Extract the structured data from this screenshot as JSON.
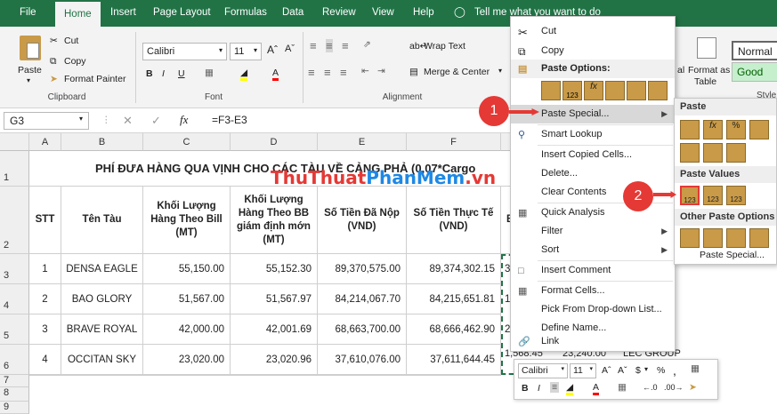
{
  "ribbon_tabs": [
    "File",
    "Home",
    "Insert",
    "Page Layout",
    "Formulas",
    "Data",
    "Review",
    "View",
    "Help"
  ],
  "tell_me": "Tell me what you want to do",
  "clipboard": {
    "paste": "Paste",
    "cut": "Cut",
    "copy": "Copy",
    "format_painter": "Format Painter",
    "label": "Clipboard"
  },
  "font": {
    "name": "Calibri",
    "size": "11",
    "label": "Font",
    "bold": "B",
    "italic": "I",
    "underline": "U"
  },
  "alignment": {
    "wrap": "Wrap Text",
    "merge": "Merge & Center",
    "label": "Alignment"
  },
  "styles": {
    "format_as": "Format as",
    "table": "Table",
    "normal": "Normal",
    "good": "Good",
    "style_partial": "Style",
    "al_partial": "al"
  },
  "formula_bar": {
    "name_box": "G3",
    "fx": "fx",
    "formula": "=F3-E3"
  },
  "columns": [
    "A",
    "B",
    "C",
    "D",
    "E",
    "F"
  ],
  "rows": [
    "1",
    "2",
    "3",
    "4",
    "5",
    "6",
    "7",
    "8",
    "9"
  ],
  "sheet": {
    "title": "PHÍ ĐƯA HÀNG QUA VỊNH CHO CÁC TÀU VỀ CẢNG PHẢ (0,07*Cargo",
    "headers": [
      "STT",
      "Tên Tàu",
      "Khối Lượng Hàng Theo Bill (MT)",
      "Khối Lượng Hàng Theo BB giám định mớn (MT)",
      "Số Tiền Đã Nộp (VND)",
      "Số Tiền Thực Tế (VND)",
      "B"
    ],
    "data": [
      [
        "1",
        "DENSA EAGLE",
        "55,150.00",
        "55,152.30",
        "89,370,575.00",
        "89,374,302.15",
        "3"
      ],
      [
        "2",
        "BAO GLORY",
        "51,567.00",
        "51,567.97",
        "84,214,067.70",
        "84,215,651.81",
        "1"
      ],
      [
        "3",
        "BRAVE ROYAL",
        "42,000.00",
        "42,001.69",
        "68,663,700.00",
        "68,666,462.90",
        "2"
      ],
      [
        "4",
        "OCCITAN SKY",
        "23,020.00",
        "23,020.96",
        "37,610,076.00",
        "37,611,644.45",
        "1,568.45"
      ]
    ],
    "extra_row6": [
      "23,240.00",
      "LEC GROUP"
    ]
  },
  "watermark": "ThuThuatPhanMem.vn",
  "context_menu": {
    "cut": "Cut",
    "copy": "Copy",
    "paste_options": "Paste Options:",
    "paste_special": "Paste Special...",
    "smart_lookup": "Smart Lookup",
    "insert_copied": "Insert Copied Cells...",
    "delete": "Delete...",
    "clear": "Clear Contents",
    "quick_analysis": "Quick Analysis",
    "filter": "Filter",
    "sort": "Sort",
    "insert_comment": "Insert Comment",
    "format_cells": "Format Cells...",
    "pick_list": "Pick From Drop-down List...",
    "define_name": "Define Name...",
    "link": "Link"
  },
  "submenu": {
    "paste": "Paste",
    "paste_values": "Paste Values",
    "other": "Other Paste Options",
    "paste_special": "Paste Special..."
  },
  "mini_toolbar": {
    "font": "Calibri",
    "size": "11",
    "bold": "B",
    "italic": "I",
    "currency": "$",
    "percent": "%",
    "comma": ","
  },
  "badges": [
    "1",
    "2"
  ],
  "colors": {
    "excel_green": "#217346",
    "badge_red": "#e53935",
    "good_fill": "#c6efce",
    "good_text": "#006100"
  }
}
